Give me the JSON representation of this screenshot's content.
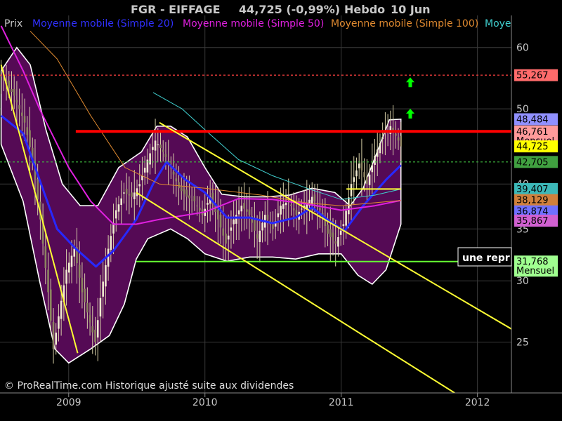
{
  "header": {
    "title": "FGR - EIFFAGE",
    "quote": "44,725 (-0,99%)",
    "period": "Hebdo",
    "date": "10 Jun"
  },
  "legend": [
    {
      "label": "Prix",
      "color": "#c8c8c8"
    },
    {
      "label": "Moyenne mobile (Simple 20)",
      "color": "#3030ff"
    },
    {
      "label": "Moyenne mobile (Simple 50)",
      "color": "#e020e0"
    },
    {
      "label": "Moyenne mobile (Simple 100)",
      "color": "#e08a30"
    },
    {
      "label": "Moye",
      "color": "#40d0d0"
    }
  ],
  "price_tags": [
    {
      "value": 55.267,
      "label": "55,267",
      "bg": "#ff6b6b",
      "fg": "#000000"
    },
    {
      "value": 48.484,
      "label": "48,484",
      "bg": "#9090ff",
      "fg": "#000000"
    },
    {
      "value": 46.761,
      "label": "46,761",
      "sub": "Mensuel",
      "bg": "#ff9a9a",
      "fg": "#000000"
    },
    {
      "value": 44.725,
      "label": "44,725",
      "bg": "#ffff00",
      "fg": "#000000"
    },
    {
      "value": 42.705,
      "label": "42,705",
      "bg": "#40a040",
      "fg": "#000000"
    },
    {
      "value": 39.407,
      "label": "39,407",
      "bg": "#3cb8b8",
      "fg": "#000000"
    },
    {
      "value": 38.129,
      "label": "38,129",
      "bg": "#d0803c",
      "fg": "#000000"
    },
    {
      "value": 36.874,
      "label": "36,874",
      "bg": "#7070ff",
      "fg": "#000000"
    },
    {
      "value": 35.867,
      "label": "35,867",
      "bg": "#d060d0",
      "fg": "#000000"
    },
    {
      "value": 31.768,
      "label": "31,768",
      "sub": "Mensuel",
      "bg": "#a0ff90",
      "fg": "#000000"
    }
  ],
  "annotation": "une repr",
  "copyright": "© ProRealTime.com Historique ajusté suite aux dividendes",
  "colors": {
    "band_fill": "#550a55",
    "band_edge": "#ffffff",
    "candle": "#d8d0a8",
    "grid": "#3a3a3a",
    "resistance": "#ff0000",
    "support": "#66ff33",
    "trend": "#ffff33",
    "dotted_red": "#ff4040",
    "dotted_green": "#40c040",
    "arrow": "#00ff00"
  },
  "chart_data": {
    "type": "line",
    "title": "FGR - EIFFAGE",
    "y_scale": "log",
    "ylim": [
      21.5,
      66
    ],
    "y_ticks": [
      25,
      30,
      35,
      40,
      50,
      60
    ],
    "xlim": [
      "2008-07-01",
      "2012-04-01"
    ],
    "x_ticks": [
      {
        "label": "2009",
        "date": "2009-01-01"
      },
      {
        "label": "2010",
        "date": "2010-01-01"
      },
      {
        "label": "2011",
        "date": "2011-01-01"
      },
      {
        "label": "2012",
        "date": "2012-01-01"
      }
    ],
    "grid": true,
    "price_path": [
      [
        "2008-07-04",
        55
      ],
      [
        "2008-08-08",
        52
      ],
      [
        "2008-09-05",
        48
      ],
      [
        "2008-09-26",
        43
      ],
      [
        "2008-10-17",
        36
      ],
      [
        "2008-11-07",
        29
      ],
      [
        "2008-11-21",
        24.5
      ],
      [
        "2008-12-05",
        27
      ],
      [
        "2008-12-26",
        31
      ],
      [
        "2009-01-16",
        33
      ],
      [
        "2009-02-06",
        29
      ],
      [
        "2009-02-27",
        26.5
      ],
      [
        "2009-03-13",
        25
      ],
      [
        "2009-03-27",
        28.5
      ],
      [
        "2009-04-17",
        33
      ],
      [
        "2009-05-08",
        37
      ],
      [
        "2009-05-29",
        39
      ],
      [
        "2009-06-19",
        38.5
      ],
      [
        "2009-07-10",
        40
      ],
      [
        "2009-07-31",
        43
      ],
      [
        "2009-08-21",
        45.5
      ],
      [
        "2009-09-11",
        44
      ],
      [
        "2009-10-02",
        42
      ],
      [
        "2009-10-23",
        39.5
      ],
      [
        "2009-11-13",
        38.5
      ],
      [
        "2009-12-04",
        38
      ],
      [
        "2009-12-25",
        36.5
      ],
      [
        "2010-01-15",
        38.5
      ],
      [
        "2010-02-05",
        36
      ],
      [
        "2010-02-26",
        33.5
      ],
      [
        "2010-03-19",
        36
      ],
      [
        "2010-04-09",
        37.5
      ],
      [
        "2010-04-30",
        36.5
      ],
      [
        "2010-05-21",
        34
      ],
      [
        "2010-06-11",
        36.5
      ],
      [
        "2010-07-02",
        35
      ],
      [
        "2010-07-23",
        37.5
      ],
      [
        "2010-08-13",
        38
      ],
      [
        "2010-09-03",
        36.5
      ],
      [
        "2010-09-24",
        37.5
      ],
      [
        "2010-10-15",
        38.5
      ],
      [
        "2010-11-05",
        37
      ],
      [
        "2010-11-26",
        34.5
      ],
      [
        "2010-12-17",
        33.5
      ],
      [
        "2011-01-07",
        35.5
      ],
      [
        "2011-01-28",
        40
      ],
      [
        "2011-02-18",
        42.5
      ],
      [
        "2011-03-11",
        40
      ],
      [
        "2011-04-01",
        43.5
      ],
      [
        "2011-04-22",
        46
      ],
      [
        "2011-05-13",
        47.5
      ],
      [
        "2011-06-03",
        45.5
      ],
      [
        "2011-06-10",
        44.725
      ]
    ],
    "series": [
      {
        "name": "Moyenne mobile (Simple 20)",
        "color": "#2828ff",
        "values": [
          [
            "2008-07-04",
            49
          ],
          [
            "2008-09-01",
            46.5
          ],
          [
            "2008-10-15",
            40.5
          ],
          [
            "2008-12-01",
            35
          ],
          [
            "2009-01-20",
            33
          ],
          [
            "2009-03-15",
            31.3
          ],
          [
            "2009-05-01",
            32.8
          ],
          [
            "2009-07-01",
            36
          ],
          [
            "2009-08-15",
            40
          ],
          [
            "2009-09-20",
            42.7
          ],
          [
            "2009-11-10",
            40.5
          ],
          [
            "2010-01-01",
            39
          ],
          [
            "2010-03-01",
            36.2
          ],
          [
            "2010-05-01",
            36.2
          ],
          [
            "2010-07-01",
            35.6
          ],
          [
            "2010-09-01",
            36.2
          ],
          [
            "2010-10-15",
            37.3
          ],
          [
            "2010-12-01",
            35.8
          ],
          [
            "2011-01-10",
            34.8
          ],
          [
            "2011-03-01",
            37.5
          ],
          [
            "2011-05-01",
            40.5
          ],
          [
            "2011-06-10",
            42.3
          ]
        ]
      },
      {
        "name": "Moyenne mobile (Simple 50)",
        "color": "#e020e0",
        "values": [
          [
            "2008-07-04",
            64
          ],
          [
            "2008-09-01",
            56
          ],
          [
            "2008-10-15",
            50
          ],
          [
            "2009-01-01",
            42
          ],
          [
            "2009-03-01",
            38
          ],
          [
            "2009-05-01",
            35.5
          ],
          [
            "2009-07-01",
            35.5
          ],
          [
            "2009-09-01",
            36
          ],
          [
            "2010-01-01",
            36.8
          ],
          [
            "2010-04-01",
            38.3
          ],
          [
            "2010-07-01",
            38.2
          ],
          [
            "2010-10-01",
            37.7
          ],
          [
            "2011-01-01",
            37
          ],
          [
            "2011-04-01",
            37.5
          ],
          [
            "2011-06-10",
            38.1
          ]
        ]
      },
      {
        "name": "Moyenne mobile (Simple 100)",
        "color": "#e08a30",
        "values": [
          [
            "2008-09-20",
            63
          ],
          [
            "2008-12-01",
            58
          ],
          [
            "2009-03-01",
            49
          ],
          [
            "2009-06-01",
            42
          ],
          [
            "2009-09-01",
            40
          ],
          [
            "2010-01-01",
            39.5
          ],
          [
            "2010-06-01",
            38.7
          ],
          [
            "2010-10-01",
            37.8
          ],
          [
            "2011-01-01",
            37.5
          ],
          [
            "2011-06-10",
            38.1
          ]
        ]
      },
      {
        "name": "Moye",
        "color": "#40d0d0",
        "values": [
          [
            "2009-08-15",
            52.5
          ],
          [
            "2009-11-01",
            50
          ],
          [
            "2010-01-01",
            47
          ],
          [
            "2010-04-01",
            43
          ],
          [
            "2010-07-01",
            41
          ],
          [
            "2010-10-01",
            39.5
          ],
          [
            "2011-01-01",
            38.2
          ],
          [
            "2011-04-01",
            38.7
          ],
          [
            "2011-06-10",
            39.4
          ]
        ]
      }
    ],
    "band_upper": [
      [
        "2008-07-04",
        56
      ],
      [
        "2008-08-15",
        60
      ],
      [
        "2008-09-20",
        57
      ],
      [
        "2008-11-01",
        47
      ],
      [
        "2008-12-15",
        40
      ],
      [
        "2009-02-01",
        37.5
      ],
      [
        "2009-03-20",
        37.5
      ],
      [
        "2009-05-15",
        42
      ],
      [
        "2009-07-15",
        44
      ],
      [
        "2009-08-25",
        47.5
      ],
      [
        "2009-10-01",
        47.5
      ],
      [
        "2009-11-15",
        46
      ],
      [
        "2010-01-01",
        42
      ],
      [
        "2010-02-15",
        38.8
      ],
      [
        "2010-04-15",
        38.5
      ],
      [
        "2010-06-15",
        38.5
      ],
      [
        "2010-08-15",
        38.7
      ],
      [
        "2010-10-15",
        39.5
      ],
      [
        "2010-12-15",
        39
      ],
      [
        "2011-01-25",
        37.5
      ],
      [
        "2011-03-01",
        39.5
      ],
      [
        "2011-04-15",
        45
      ],
      [
        "2011-05-10",
        48.4
      ],
      [
        "2011-06-10",
        48.5
      ]
    ],
    "band_lower": [
      [
        "2008-07-04",
        45
      ],
      [
        "2008-09-01",
        38
      ],
      [
        "2008-10-15",
        30
      ],
      [
        "2008-11-25",
        24.5
      ],
      [
        "2009-01-01",
        23.5
      ],
      [
        "2009-03-01",
        24.5
      ],
      [
        "2009-04-20",
        25.5
      ],
      [
        "2009-05-30",
        28
      ],
      [
        "2009-07-01",
        32
      ],
      [
        "2009-08-01",
        34
      ],
      [
        "2009-10-01",
        35
      ],
      [
        "2009-11-15",
        34
      ],
      [
        "2010-01-01",
        32.5
      ],
      [
        "2010-03-01",
        31.8
      ],
      [
        "2010-05-01",
        32.2
      ],
      [
        "2010-07-01",
        32.2
      ],
      [
        "2010-09-01",
        32
      ],
      [
        "2010-11-01",
        32.5
      ],
      [
        "2011-01-01",
        32.5
      ],
      [
        "2011-02-15",
        30.5
      ],
      [
        "2011-03-25",
        29.7
      ],
      [
        "2011-05-01",
        31
      ],
      [
        "2011-06-10",
        35.5
      ]
    ],
    "resistance_line": {
      "value": 46.761,
      "from": "2009-01-20",
      "to": "2012-04-01"
    },
    "support_line": {
      "value": 31.768,
      "from": "2009-07-01",
      "to": "2012-04-01"
    },
    "dotted_levels": [
      {
        "value": 55.267,
        "color": "#ff4040"
      },
      {
        "value": 42.705,
        "color": "#40c040"
      }
    ],
    "short_levels": [
      {
        "value": 39.407,
        "from": "2011-01-15",
        "to": "2011-06-10",
        "color": "#ffff33"
      }
    ],
    "trend_lines": [
      {
        "from": [
          "2008-07-04",
          57
        ],
        "to": [
          "2009-01-25",
          24.2
        ]
      },
      {
        "from": [
          "2009-09-01",
          48
        ],
        "to": [
          "2012-04-01",
          26
        ]
      },
      {
        "from": [
          "2009-07-01",
          39
        ],
        "to": [
          "2011-11-01",
          21.5
        ]
      }
    ],
    "arrows": [
      {
        "date": "2011-07-05",
        "value": 54
      },
      {
        "date": "2011-07-05",
        "value": 49.2
      }
    ]
  }
}
